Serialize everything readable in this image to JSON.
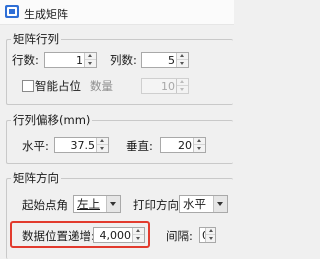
{
  "window": {
    "title": "生成矩阵"
  },
  "matrix_rows_cols": {
    "title": "矩阵行列",
    "rows_label": "行数:",
    "rows_value": "1",
    "cols_label": "列数:",
    "cols_value": "5",
    "smart_placeholder_label": "智能占位",
    "quantity_label": "数量",
    "quantity_value": "10"
  },
  "offset": {
    "title": "行列偏移(mm)",
    "horizontal_label": "水平:",
    "horizontal_value": "37.5",
    "vertical_label": "垂直:",
    "vertical_value": "20"
  },
  "direction": {
    "title": "矩阵方向",
    "start_corner_label": "起始点角",
    "start_corner_value": "左上",
    "print_direction_label": "打印方向",
    "print_direction_value": "水平",
    "data_increment_label": "数据位置递增:",
    "data_increment_value": "4,000",
    "interval_label": "间隔:",
    "interval_value": "0"
  },
  "colors": {
    "highlight": "#e23b2e",
    "app_icon": "#2f6fd6"
  }
}
